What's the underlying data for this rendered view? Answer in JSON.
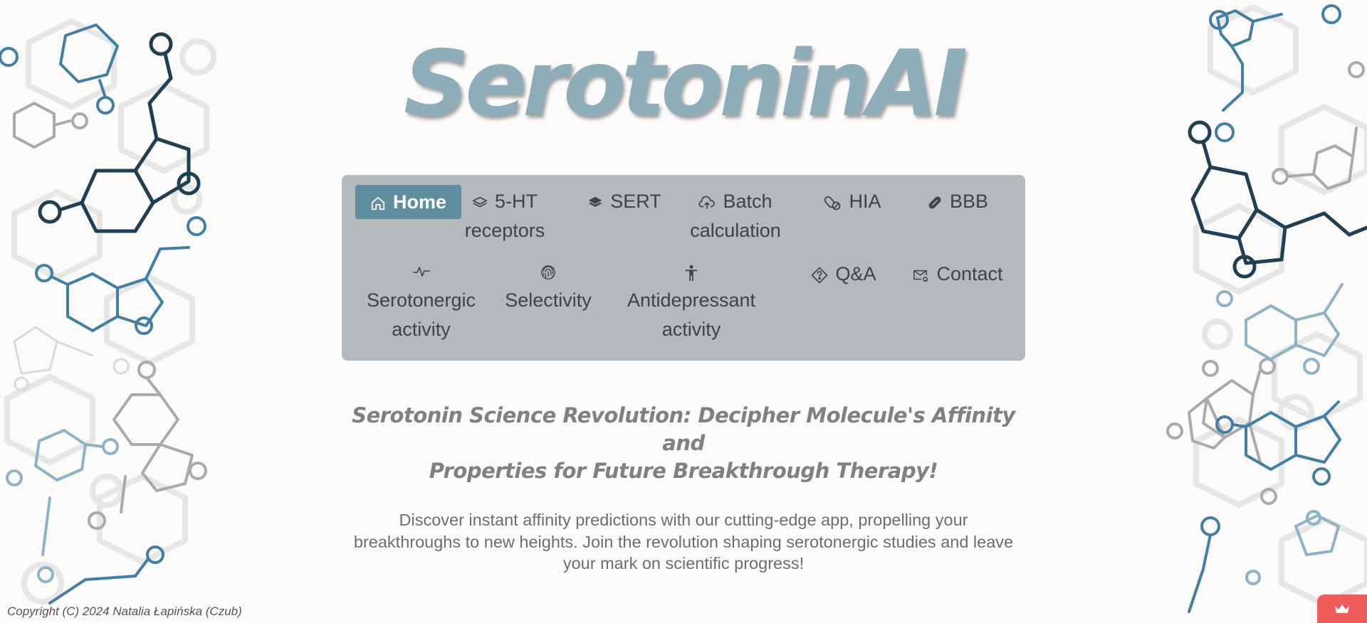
{
  "app": {
    "logo": "SerotoninAI"
  },
  "nav": {
    "items": [
      {
        "label": "Home",
        "icon": "home-icon",
        "active": true
      },
      {
        "label_line1": "5-HT",
        "label_line2": "receptors",
        "icon": "layers-icon"
      },
      {
        "label": "SERT",
        "icon": "layers-filled-icon"
      },
      {
        "label_line1": "Batch",
        "label_line2": "calculation",
        "icon": "cloud-upload-icon"
      },
      {
        "label": "HIA",
        "icon": "pill-capsule-icon"
      },
      {
        "label": "BBB",
        "icon": "capsule-icon"
      },
      {
        "label_line1": "Serotonergic",
        "label_line2": "activity",
        "icon": "activity-pulse-icon"
      },
      {
        "label": "Selectivity",
        "icon": "fingerprint-icon"
      },
      {
        "label_line1": "Antidepressant",
        "label_line2": "activity",
        "icon": "person-icon"
      },
      {
        "label": "Q&A",
        "icon": "question-diamond-icon"
      },
      {
        "label": "Contact",
        "icon": "envelope-at-icon"
      }
    ]
  },
  "main": {
    "tagline_line1": "Serotonin Science Revolution: Decipher Molecule's Affinity and",
    "tagline_line2": "Properties for Future Breakthrough Therapy!",
    "description_line1": "Discover instant affinity predictions with our cutting-edge app, propelling your",
    "description_line2": "breakthroughs to new heights. Join the revolution shaping serotonergic studies and leave",
    "description_line3": "your mark on scientific progress!"
  },
  "footer": {
    "copyright": "Copyright (C) 2024 Natalia Łapińska (Czub)"
  },
  "colors": {
    "background": "#fcfbfa",
    "logo": "#8dadb9",
    "nav_background": "#b3b9bd",
    "nav_active": "#5f8e9f",
    "crown_button": "#f05b5b"
  },
  "widget": {
    "icon": "crown-icon"
  }
}
